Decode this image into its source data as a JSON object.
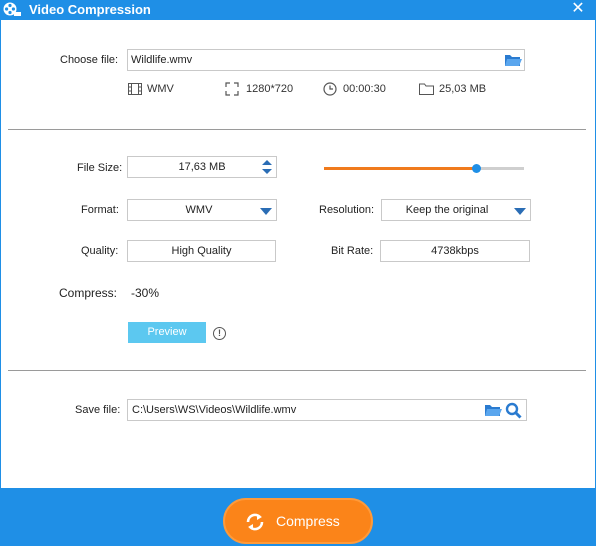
{
  "window": {
    "title": "Video Compression",
    "close_glyph": "✕"
  },
  "file": {
    "choose_label": "Choose file:",
    "name": "Wildlife.wmv",
    "format": "WMV",
    "resolution": "1280*720",
    "duration": "00:00:30",
    "size": "25,03 MB"
  },
  "settings": {
    "file_size_label": "File Size:",
    "file_size_value": "17,63 MB",
    "size_slider_fraction": 0.76,
    "format_label": "Format:",
    "format_value": "WMV",
    "resolution_label": "Resolution:",
    "resolution_value": "Keep the original",
    "quality_label": "Quality:",
    "quality_value": "High Quality",
    "bitrate_label": "Bit Rate:",
    "bitrate_value": "4738kbps",
    "compress_label": "Compress:",
    "compress_value": "-30%",
    "preview_label": "Preview",
    "info_glyph": "!"
  },
  "save": {
    "label": "Save file:",
    "path": "C:\\Users\\WS\\Videos\\Wildlife.wmv"
  },
  "action": {
    "compress_label": "Compress"
  },
  "colors": {
    "title_bar": "#1f8fe6",
    "accent_orange": "#fb8419",
    "preview_button": "#5cc8f0",
    "icon_blue": "#2a6db5"
  }
}
